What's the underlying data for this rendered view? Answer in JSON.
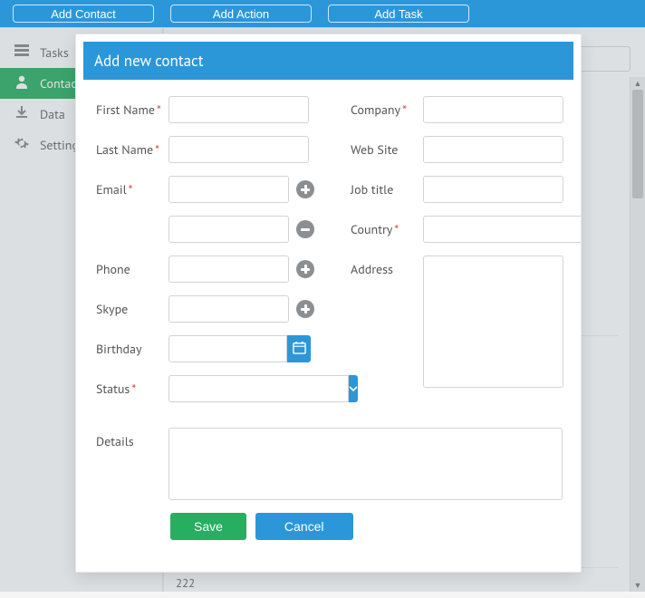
{
  "colors": {
    "primary_blue": "#2b97d9",
    "primary_green": "#27ae60",
    "required_red": "#e04040"
  },
  "topbar": {
    "buttons": {
      "addContact": "Add Contact",
      "addAction": "Add Action",
      "addTask": "Add Task"
    }
  },
  "sidebar": {
    "items": [
      {
        "id": "tasks",
        "label": "Tasks",
        "icon": "list-icon"
      },
      {
        "id": "contacts",
        "label": "Contacts",
        "icon": "user-icon",
        "active": true
      },
      {
        "id": "data",
        "label": "Data",
        "icon": "download-icon"
      },
      {
        "id": "settings",
        "label": "Settings",
        "icon": "gear-icon"
      }
    ]
  },
  "background_list": {
    "placeholder_row_value": "222"
  },
  "modal": {
    "title": "Add new contact",
    "required_marker": "*",
    "labels": {
      "firstName": "First Name",
      "lastName": "Last Name",
      "email": "Email",
      "phone": "Phone",
      "skype": "Skype",
      "birthday": "Birthday",
      "status": "Status",
      "details": "Details",
      "company": "Company",
      "website": "Web Site",
      "jobTitle": "Job title",
      "country": "Country",
      "address": "Address"
    },
    "values": {
      "firstName": "",
      "lastName": "",
      "email1": "",
      "email2": "",
      "phone": "",
      "skype": "",
      "birthday": "",
      "status": "",
      "details": "",
      "company": "",
      "website": "",
      "jobTitle": "",
      "country": "",
      "address": ""
    },
    "buttons": {
      "save": "Save",
      "cancel": "Cancel"
    },
    "icons": {
      "addRow": "plus-icon",
      "removeRow": "minus-icon",
      "calendar": "calendar-icon",
      "dropdown": "chevron-down-icon"
    }
  }
}
